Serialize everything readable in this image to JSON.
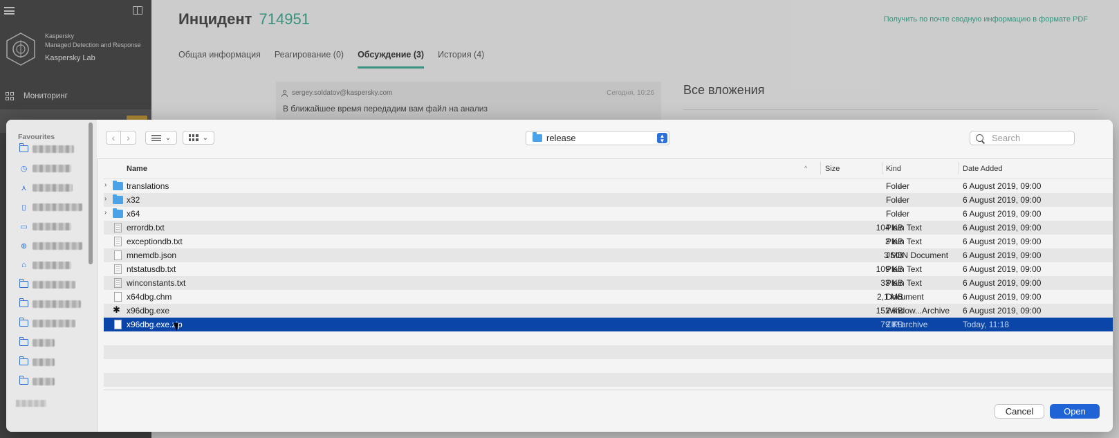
{
  "app": {
    "brand_line1": "Kaspersky",
    "brand_line2": "Managed Detection and Response",
    "company": "Kaspersky Lab",
    "nav_monitoring": "Мониторинг",
    "title_prefix": "Инцидент",
    "incident_number": "714951",
    "pdf_link": "Получить по почте сводную информацию в формате PDF",
    "tabs": [
      {
        "label": "Общая информация"
      },
      {
        "label": "Реагирование (0)"
      },
      {
        "label": "Обсуждение (3)",
        "active": true
      },
      {
        "label": "История (4)"
      }
    ],
    "comment": {
      "author": "sergey.soldatov@kaspersky.com",
      "time": "Сегодня, 10:26",
      "text": "В ближайшее время передадим вам файл на анализ"
    },
    "attachments_title": "Все вложения",
    "accent": "#3fa58f"
  },
  "dialog": {
    "sidebar_title": "Favourites",
    "favourites_icons": [
      "folder-icon",
      "clock-icon",
      "apps-icon",
      "document-icon",
      "drive-icon",
      "download-icon",
      "home-icon",
      "folder-icon",
      "folder-icon",
      "folder-icon",
      "folder-icon",
      "folder-icon",
      "folder-icon"
    ],
    "path": "release",
    "search_placeholder": "Search",
    "columns": {
      "name": "Name",
      "size": "Size",
      "kind": "Kind",
      "date": "Date Added"
    },
    "files": [
      {
        "name": "translations",
        "size": "--",
        "kind": "Folder",
        "date": "6 August 2019, 09:00",
        "icon": "folder",
        "expandable": true
      },
      {
        "name": "x32",
        "size": "--",
        "kind": "Folder",
        "date": "6 August 2019, 09:00",
        "icon": "folder",
        "expandable": true
      },
      {
        "name": "x64",
        "size": "--",
        "kind": "Folder",
        "date": "6 August 2019, 09:00",
        "icon": "folder",
        "expandable": true
      },
      {
        "name": "errordb.txt",
        "size": "104 KB",
        "kind": "Plain Text",
        "date": "6 August 2019, 09:00",
        "icon": "text"
      },
      {
        "name": "exceptiondb.txt",
        "size": "3 KB",
        "kind": "Plain Text",
        "date": "6 August 2019, 09:00",
        "icon": "text"
      },
      {
        "name": "mnemdb.json",
        "size": "3 MB",
        "kind": "JSON Document",
        "date": "6 August 2019, 09:00",
        "icon": "doc"
      },
      {
        "name": "ntstatusdb.txt",
        "size": "109 KB",
        "kind": "Plain Text",
        "date": "6 August 2019, 09:00",
        "icon": "text"
      },
      {
        "name": "winconstants.txt",
        "size": "33 KB",
        "kind": "Plain Text",
        "date": "6 August 2019, 09:00",
        "icon": "text"
      },
      {
        "name": "x64dbg.chm",
        "size": "2,1 MB",
        "kind": "Document",
        "date": "6 August 2019, 09:00",
        "icon": "doc"
      },
      {
        "name": "x96dbg.exe",
        "size": "152 KB",
        "kind": "Window...Archive",
        "date": "6 August 2019, 09:00",
        "icon": "bug"
      },
      {
        "name": "x96dbg.exe.zip",
        "size": "79 KB",
        "kind": "ZIP archive",
        "date": "Today, 11:18",
        "icon": "doc",
        "selected": true
      }
    ],
    "cancel_label": "Cancel",
    "open_label": "Open",
    "selection_color": "#0c45a8",
    "primary_color": "#1f63d6"
  }
}
